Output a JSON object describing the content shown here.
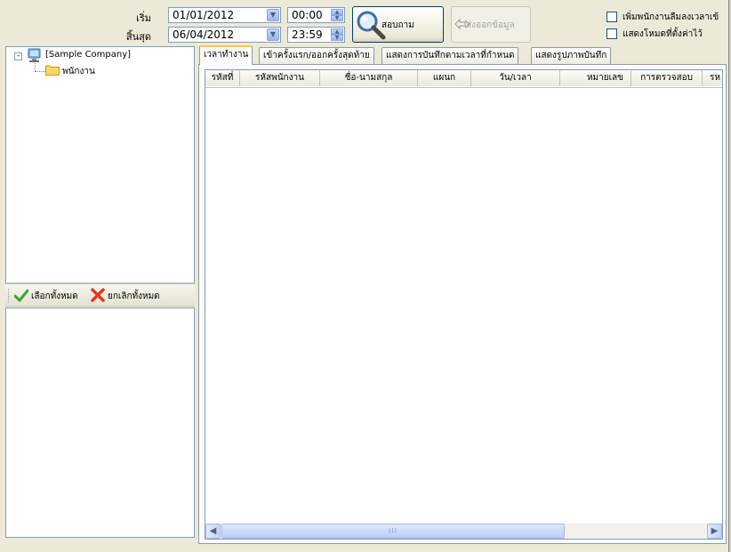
{
  "filters": {
    "start_label": "เริ่ม",
    "end_label": "สิ้นสุด",
    "start_date": "01/01/2012",
    "end_date": "06/04/2012",
    "start_time": "00:00",
    "end_time": "23:59",
    "query_button": "สอบถาม",
    "export_button": "ส่งออกข้อมูล",
    "option_add_forgot": "เพิ่มพนักงานลืมลงเวลาเข้",
    "option_show_mode": "แสดงโหมดที่ตั้งค่าไว้"
  },
  "tree": {
    "root": "[Sample Company]",
    "child": "พนักงาน"
  },
  "toolbar": {
    "select_all": "เลือกทั้งหมด",
    "deselect_all": "ยกเลิกทั้งหมด"
  },
  "tabs": [
    {
      "label": "เวลาทำงาน"
    },
    {
      "label": "เข้าครั้งแรก/ออกครั้งสุดท้าย"
    },
    {
      "label": "แสดงการบันทึกตามเวลาที่กำหนด"
    },
    {
      "label": "แสดงรูปภาพบันทึก"
    }
  ],
  "columns": [
    "รหัสที่",
    "รหัสพนักงาน",
    "ชื่อ-นามสกุล",
    "แผนก",
    "วัน/เวลา",
    "หมายเลข",
    "การตรวจสอบ",
    "รห"
  ],
  "scrollbar": {
    "grip": "III"
  }
}
